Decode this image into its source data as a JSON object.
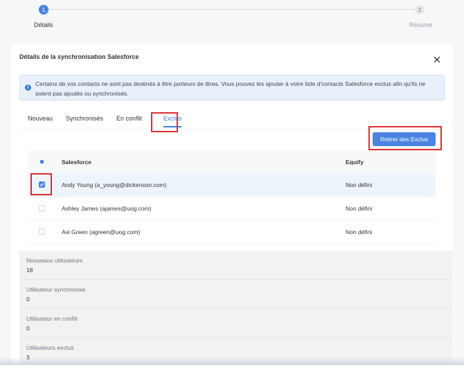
{
  "stepper": {
    "steps": [
      {
        "number": "1",
        "label": "Détails"
      },
      {
        "number": "2",
        "label": "Résumé"
      }
    ]
  },
  "card": {
    "title": "Détails de la synchronisation Salesforce",
    "close_icon": "close-icon"
  },
  "alert": {
    "icon": "info-icon",
    "icon_glyph": "i",
    "text": "Certains de vos contacts ne sont pas destinés à être porteurs de titres. Vous pouvez les ajouter à votre liste d'contacts Salesforce exclus afin qu'ils ne soient pas ajoutés ou synchronisés."
  },
  "tabs": [
    {
      "label": "Nouveau"
    },
    {
      "label": "Synchronisés"
    },
    {
      "label": "En conflit"
    },
    {
      "label": "Exclus",
      "active": true
    }
  ],
  "actions": {
    "remove_label": "Retirer des Exclus"
  },
  "table": {
    "headers": {
      "salesforce": "Salesforce",
      "equify": "Equify"
    },
    "rows": [
      {
        "salesforce": "Andy Young (a_young@dickenson.com)",
        "equify": "Non défini",
        "checked": true
      },
      {
        "salesforce": "Ashley James (ajames@uog.com)",
        "equify": "Non défini",
        "checked": false
      },
      {
        "salesforce": "Avi Green (agreen@uog.com)",
        "equify": "Non défini",
        "checked": false
      }
    ]
  },
  "stats": [
    {
      "label": "Nouveaux utilisateurs",
      "value": "18"
    },
    {
      "label": "Utilisateur synchronisé",
      "value": "0"
    },
    {
      "label": "Utilisateur en conflit",
      "value": "0"
    },
    {
      "label": "Utilisateurs exclus",
      "value": "3"
    }
  ],
  "colors": {
    "accent": "#4a84e0",
    "highlight": "#e12b2b",
    "alert_bg": "#e8f1fb"
  }
}
